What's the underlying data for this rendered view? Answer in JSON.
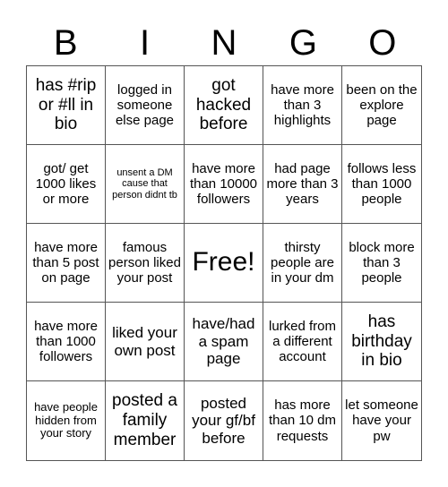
{
  "header": {
    "letters": [
      "B",
      "I",
      "N",
      "G",
      "O"
    ]
  },
  "cells": [
    {
      "text": "has #rip or #ll in bio"
    },
    {
      "text": "logged in someone else page"
    },
    {
      "text": "got hacked before"
    },
    {
      "text": "have more than 3 highlights"
    },
    {
      "text": "been on the explore page"
    },
    {
      "text": "got/ get 1000 likes or more"
    },
    {
      "text": "unsent a DM cause that person didnt tb"
    },
    {
      "text": "have more than 10000 followers"
    },
    {
      "text": "had page more than 3 years"
    },
    {
      "text": "follows less than 1000 people"
    },
    {
      "text": "have more than 5 post on page"
    },
    {
      "text": "famous person liked your post"
    },
    {
      "text": "Free!"
    },
    {
      "text": "thirsty people are in your dm"
    },
    {
      "text": "block more than 3 people"
    },
    {
      "text": "have more than 1000 followers"
    },
    {
      "text": "liked your own post"
    },
    {
      "text": "have/had a spam page"
    },
    {
      "text": "lurked from a different account"
    },
    {
      "text": "has birthday in bio"
    },
    {
      "text": "have people hidden from your story"
    },
    {
      "text": "posted a family member"
    },
    {
      "text": "posted your gf/bf before"
    },
    {
      "text": "has more than 10 dm requests"
    },
    {
      "text": "let someone have your pw"
    }
  ]
}
